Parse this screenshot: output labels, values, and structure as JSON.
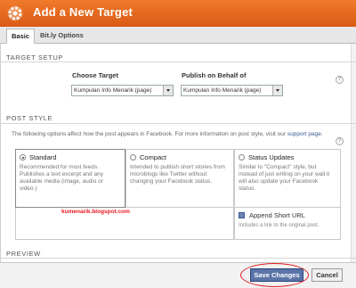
{
  "window": {
    "title": "Add a New Target"
  },
  "tabs": [
    {
      "label": "Basic",
      "active": true
    },
    {
      "label": "Bit.ly Options",
      "active": false
    }
  ],
  "target_setup": {
    "heading": "TARGET SETUP",
    "choose_target_label": "Choose Target",
    "choose_target_value": "Kumpulan Info Menarik (page)",
    "publish_label": "Publish on Behalf of",
    "publish_value": "Kumpulan Info Menarik (page)",
    "help": "?"
  },
  "post_style": {
    "heading": "POST STYLE",
    "description": "The following options affect how the post appears in Facebook. For more information on post style, visit our",
    "description_link": "support page",
    "description_end": ".",
    "help": "?",
    "options": [
      {
        "label": "Standard",
        "selected": true,
        "text": "Recommended for most feeds. Publishes a text excerpt and any available media (image, audio or video.)"
      },
      {
        "label": "Compact",
        "selected": false,
        "text": "Intended to publish short stories from microblogs like Twitter without changing your Facebook status."
      },
      {
        "label": "Status Updates",
        "selected": false,
        "text": "Similar to \"Compact\" style, but instead of just writing on your wall it will also update your Facebook status."
      }
    ],
    "append_short_url": {
      "label": "Append Short URL",
      "checked": true,
      "note": "Includes a link to the original post."
    }
  },
  "watermark": "kumenarik.blogspot.com",
  "preview": {
    "heading": "PREVIEW"
  },
  "footer": {
    "save_label": "Save Changes",
    "cancel_label": "Cancel"
  },
  "colors": {
    "titlebar": "#e8661f",
    "button_primary": "#5b74a8",
    "highlight_ring": "#e11c1c"
  }
}
